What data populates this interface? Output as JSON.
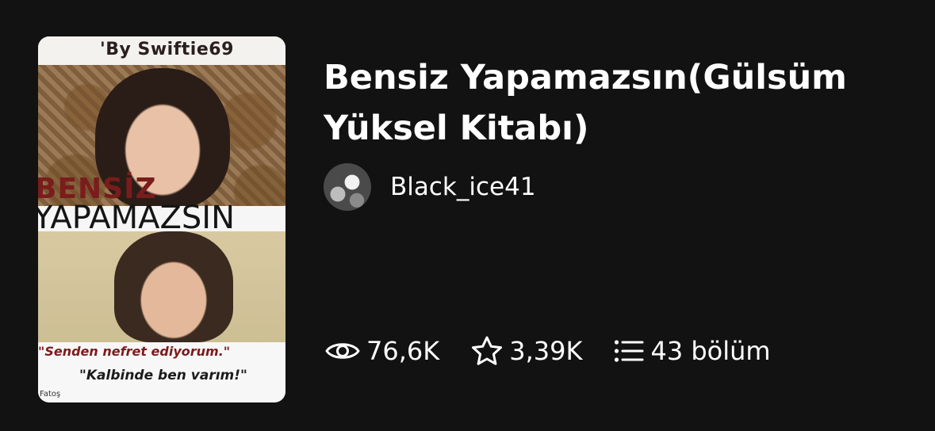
{
  "story": {
    "title": "Bensiz Yapamazsın(Gülsüm Yüksel Kitabı)",
    "author": "Black_ice41"
  },
  "cover": {
    "author_credit": "'By Swiftie69",
    "title_line_1": "BENSİZ",
    "title_line_2": "YAPAMAZSIN",
    "quote_1": "\"Senden nefret ediyorum.\"",
    "quote_2": "\"Kalbinde ben varım!\"",
    "signature": "Fatoş"
  },
  "stats": {
    "reads": {
      "icon": "eye-icon",
      "value": "76,6K"
    },
    "votes": {
      "icon": "star-icon",
      "value": "3,39K"
    },
    "parts": {
      "icon": "list-icon",
      "value": "43 bölüm"
    }
  },
  "colors": {
    "background": "#121212",
    "text": "#ffffff"
  }
}
